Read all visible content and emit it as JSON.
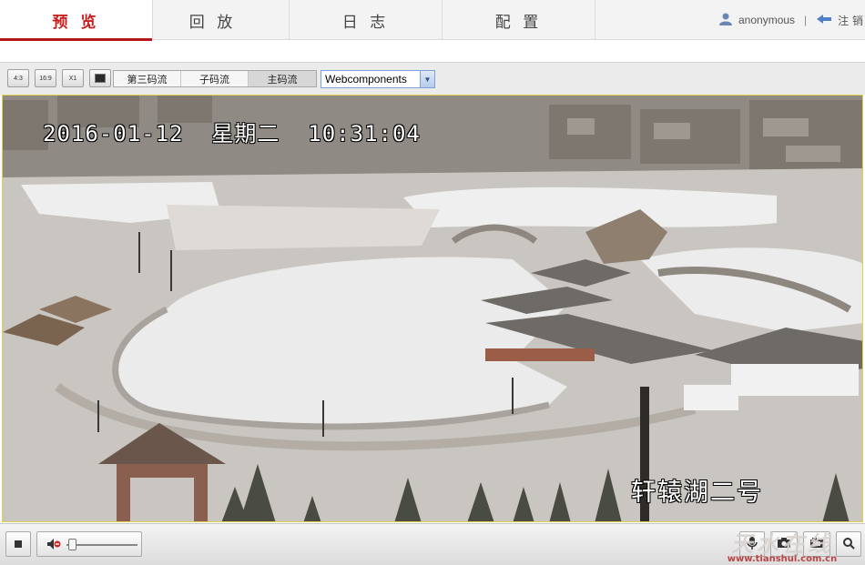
{
  "nav": {
    "tabs": [
      {
        "label": "预 览",
        "active": true
      },
      {
        "label": "回 放",
        "active": false
      },
      {
        "label": "日 志",
        "active": false
      },
      {
        "label": "配 置",
        "active": false
      }
    ],
    "user": "anonymous",
    "separator": "|",
    "logout_label": "注 销"
  },
  "toolbar": {
    "ratio_buttons": [
      "4:3",
      "16:9",
      "X1"
    ],
    "streams": [
      {
        "label": "第三码流",
        "active": false
      },
      {
        "label": "子码流",
        "active": false
      },
      {
        "label": "主码流",
        "active": true
      }
    ],
    "plugin_select": "Webcomponents"
  },
  "video": {
    "timestamp": "2016-01-12  星期二  10:31:04",
    "camera_name": "轩辕湖二号"
  },
  "controls": {
    "volume_level": 0.08
  },
  "watermark": {
    "title": "天水在线",
    "url": "www.tianshui.com.cn"
  }
}
